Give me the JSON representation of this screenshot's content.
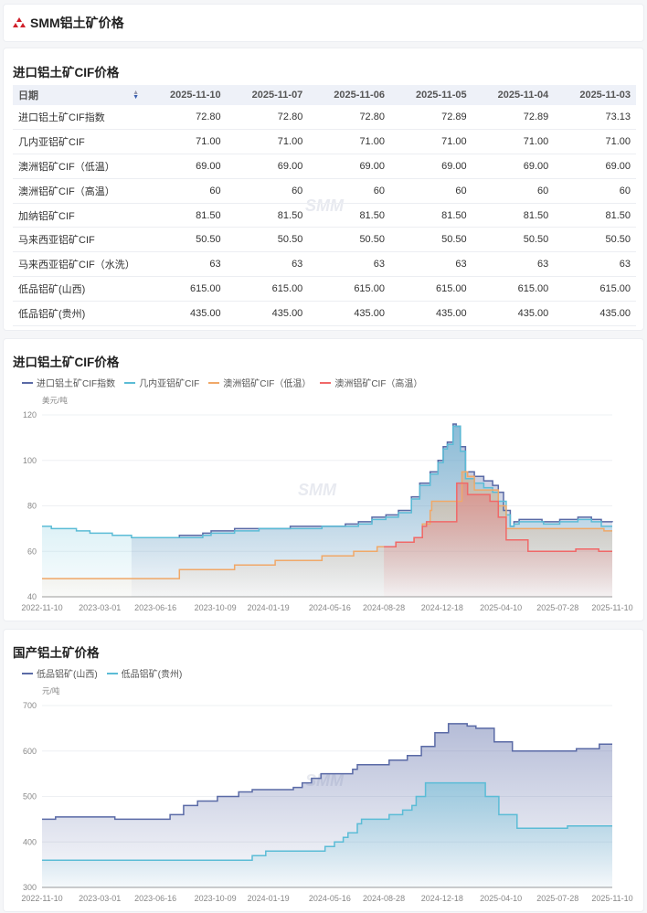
{
  "header": {
    "title": "SMM铝土矿价格",
    "logo": "smm-logo-icon"
  },
  "table_section": {
    "title": "进口铝土矿CIF价格",
    "columns": [
      "日期",
      "2025-11-10",
      "2025-11-07",
      "2025-11-06",
      "2025-11-05",
      "2025-11-04",
      "2025-11-03"
    ],
    "rows": [
      [
        "进口铝土矿CIF指数",
        "72.80",
        "72.80",
        "72.80",
        "72.89",
        "72.89",
        "73.13"
      ],
      [
        "几内亚铝矿CIF",
        "71.00",
        "71.00",
        "71.00",
        "71.00",
        "71.00",
        "71.00"
      ],
      [
        "澳洲铝矿CIF（低温）",
        "69.00",
        "69.00",
        "69.00",
        "69.00",
        "69.00",
        "69.00"
      ],
      [
        "澳洲铝矿CIF（高温）",
        "60",
        "60",
        "60",
        "60",
        "60",
        "60"
      ],
      [
        "加纳铝矿CIF",
        "81.50",
        "81.50",
        "81.50",
        "81.50",
        "81.50",
        "81.50"
      ],
      [
        "马来西亚铝矿CIF",
        "50.50",
        "50.50",
        "50.50",
        "50.50",
        "50.50",
        "50.50"
      ],
      [
        "马来西亚铝矿CIF（水洗）",
        "63",
        "63",
        "63",
        "63",
        "63",
        "63"
      ],
      [
        "低品铝矿(山西)",
        "615.00",
        "615.00",
        "615.00",
        "615.00",
        "615.00",
        "615.00"
      ],
      [
        "低品铝矿(贵州)",
        "435.00",
        "435.00",
        "435.00",
        "435.00",
        "435.00",
        "435.00"
      ]
    ]
  },
  "watermark": "SMM",
  "chart_data": [
    {
      "type": "area",
      "title": "进口铝土矿CIF价格",
      "ylabel": "美元/吨",
      "ylim": [
        40,
        120
      ],
      "yticks": [
        "40",
        "60",
        "80",
        "100",
        "120"
      ],
      "xlim": [
        "2022-11-10",
        "2025-11-10"
      ],
      "xticks": [
        "2022-11-10",
        "2023-03-01",
        "2023-06-16",
        "2023-10-09",
        "2024-01-19",
        "2024-05-16",
        "2024-08-28",
        "2024-12-18",
        "2025-04-10",
        "2025-07-28",
        "2025-11-10"
      ],
      "legend": "top-left",
      "grid": true,
      "series": [
        {
          "name": "进口铝土矿CIF指数",
          "color": "#5a6aa6",
          "points": [
            [
              "2023-05-01",
              66
            ],
            [
              "2023-08-01",
              67
            ],
            [
              "2023-09-15",
              68
            ],
            [
              "2023-10-01",
              69
            ],
            [
              "2023-11-15",
              70
            ],
            [
              "2024-03-01",
              71
            ],
            [
              "2024-06-15",
              72
            ],
            [
              "2024-07-10",
              73
            ],
            [
              "2024-08-05",
              75
            ],
            [
              "2024-09-01",
              76
            ],
            [
              "2024-09-25",
              78
            ],
            [
              "2024-10-20",
              84
            ],
            [
              "2024-11-05",
              90
            ],
            [
              "2024-11-25",
              95
            ],
            [
              "2024-12-10",
              100
            ],
            [
              "2024-12-20",
              106
            ],
            [
              "2024-12-28",
              108
            ],
            [
              "2025-01-08",
              116
            ],
            [
              "2025-01-14",
              115
            ],
            [
              "2025-01-22",
              106
            ],
            [
              "2025-02-01",
              95
            ],
            [
              "2025-02-18",
              93
            ],
            [
              "2025-03-08",
              91
            ],
            [
              "2025-03-25",
              89
            ],
            [
              "2025-04-05",
              86
            ],
            [
              "2025-04-15",
              78
            ],
            [
              "2025-04-28",
              71
            ],
            [
              "2025-05-05",
              73
            ],
            [
              "2025-05-15",
              74
            ],
            [
              "2025-06-28",
              73
            ],
            [
              "2025-08-01",
              74
            ],
            [
              "2025-09-05",
              75
            ],
            [
              "2025-10-01",
              74
            ],
            [
              "2025-10-20",
              73
            ],
            [
              "2025-11-10",
              72.8
            ]
          ]
        },
        {
          "name": "几内亚铝矿CIF",
          "color": "#5bbcd6",
          "points": [
            [
              "2022-11-10",
              71
            ],
            [
              "2022-11-28",
              70
            ],
            [
              "2023-01-15",
              69
            ],
            [
              "2023-02-10",
              68
            ],
            [
              "2023-03-25",
              67
            ],
            [
              "2023-05-01",
              66
            ],
            [
              "2023-08-01",
              66
            ],
            [
              "2023-09-15",
              67
            ],
            [
              "2023-10-01",
              68
            ],
            [
              "2023-11-15",
              69
            ],
            [
              "2024-01-01",
              70
            ],
            [
              "2024-05-01",
              71
            ],
            [
              "2024-07-10",
              72
            ],
            [
              "2024-08-05",
              74
            ],
            [
              "2024-09-01",
              75
            ],
            [
              "2024-09-25",
              77
            ],
            [
              "2024-10-20",
              83
            ],
            [
              "2024-11-05",
              89
            ],
            [
              "2024-11-25",
              94
            ],
            [
              "2024-12-10",
              99
            ],
            [
              "2024-12-20",
              105
            ],
            [
              "2024-12-28",
              107
            ],
            [
              "2025-01-08",
              115
            ],
            [
              "2025-01-22",
              104
            ],
            [
              "2025-02-01",
              92
            ],
            [
              "2025-02-18",
              90
            ],
            [
              "2025-03-08",
              88
            ],
            [
              "2025-03-25",
              86
            ],
            [
              "2025-04-05",
              82
            ],
            [
              "2025-04-20",
              76
            ],
            [
              "2025-04-28",
              71
            ],
            [
              "2025-05-05",
              72
            ],
            [
              "2025-05-15",
              73
            ],
            [
              "2025-07-01",
              72
            ],
            [
              "2025-08-01",
              73
            ],
            [
              "2025-09-05",
              74
            ],
            [
              "2025-10-01",
              73
            ],
            [
              "2025-10-20",
              71
            ],
            [
              "2025-11-10",
              71
            ]
          ]
        },
        {
          "name": "澳洲铝矿CIF（低温）",
          "color": "#f0a868",
          "points": [
            [
              "2022-11-10",
              48
            ],
            [
              "2023-08-01",
              52
            ],
            [
              "2023-11-15",
              54
            ],
            [
              "2024-02-01",
              56
            ],
            [
              "2024-05-01",
              58
            ],
            [
              "2024-07-01",
              60
            ],
            [
              "2024-08-15",
              62
            ],
            [
              "2024-09-20",
              64
            ],
            [
              "2024-10-25",
              66
            ],
            [
              "2024-11-10",
              72
            ],
            [
              "2024-11-25",
              78
            ],
            [
              "2024-11-28",
              82
            ],
            [
              "2025-01-25",
              95
            ],
            [
              "2025-02-05",
              93
            ],
            [
              "2025-02-18",
              87
            ],
            [
              "2025-04-05",
              80
            ],
            [
              "2025-04-20",
              70
            ],
            [
              "2025-10-25",
              69
            ],
            [
              "2025-11-10",
              69
            ]
          ]
        },
        {
          "name": "澳洲铝矿CIF（高温）",
          "color": "#f06868",
          "points": [
            [
              "2024-08-28",
              62
            ],
            [
              "2024-09-20",
              64
            ],
            [
              "2024-10-25",
              66
            ],
            [
              "2024-11-10",
              71
            ],
            [
              "2024-11-18",
              73
            ],
            [
              "2025-01-15",
              90
            ],
            [
              "2025-02-05",
              85
            ],
            [
              "2025-03-20",
              82
            ],
            [
              "2025-04-05",
              75
            ],
            [
              "2025-04-20",
              65
            ],
            [
              "2025-06-01",
              60
            ],
            [
              "2025-09-01",
              61
            ],
            [
              "2025-10-15",
              60
            ],
            [
              "2025-11-10",
              60
            ]
          ]
        }
      ]
    },
    {
      "type": "area",
      "title": "国产铝土矿价格",
      "ylabel": "元/吨",
      "ylim": [
        300,
        700
      ],
      "yticks": [
        "300",
        "400",
        "500",
        "600",
        "700"
      ],
      "xlim": [
        "2022-11-10",
        "2025-11-10"
      ],
      "xticks": [
        "2022-11-10",
        "2023-03-01",
        "2023-06-16",
        "2023-10-09",
        "2024-01-19",
        "2024-05-16",
        "2024-08-28",
        "2024-12-18",
        "2025-04-10",
        "2025-07-28",
        "2025-11-10"
      ],
      "legend": "top-left",
      "grid": true,
      "series": [
        {
          "name": "低品铝矿(山西)",
          "color": "#5a6aa6",
          "points": [
            [
              "2022-11-10",
              450
            ],
            [
              "2022-12-06",
              455
            ],
            [
              "2023-03-30",
              450
            ],
            [
              "2023-07-14",
              460
            ],
            [
              "2023-08-09",
              480
            ],
            [
              "2023-09-05",
              490
            ],
            [
              "2023-10-13",
              500
            ],
            [
              "2023-11-23",
              510
            ],
            [
              "2023-12-19",
              515
            ],
            [
              "2024-03-07",
              520
            ],
            [
              "2024-03-24",
              530
            ],
            [
              "2024-04-11",
              540
            ],
            [
              "2024-04-29",
              550
            ],
            [
              "2024-06-29",
              560
            ],
            [
              "2024-07-08",
              570
            ],
            [
              "2024-09-07",
              580
            ],
            [
              "2024-10-12",
              590
            ],
            [
              "2024-11-08",
              610
            ],
            [
              "2024-12-04",
              640
            ],
            [
              "2024-12-30",
              660
            ],
            [
              "2025-02-04",
              655
            ],
            [
              "2025-02-21",
              650
            ],
            [
              "2025-03-28",
              620
            ],
            [
              "2025-05-02",
              600
            ],
            [
              "2025-09-02",
              605
            ],
            [
              "2025-10-16",
              615
            ],
            [
              "2025-11-10",
              615
            ]
          ]
        },
        {
          "name": "低品铝矿(贵州)",
          "color": "#5bbcd6",
          "points": [
            [
              "2022-11-10",
              360
            ],
            [
              "2023-12-19",
              370
            ],
            [
              "2024-01-14",
              380
            ],
            [
              "2024-05-07",
              390
            ],
            [
              "2024-05-25",
              400
            ],
            [
              "2024-06-11",
              410
            ],
            [
              "2024-06-20",
              420
            ],
            [
              "2024-07-08",
              440
            ],
            [
              "2024-07-16",
              450
            ],
            [
              "2024-09-07",
              460
            ],
            [
              "2024-10-03",
              470
            ],
            [
              "2024-10-21",
              480
            ],
            [
              "2024-10-29",
              500
            ],
            [
              "2024-11-16",
              530
            ],
            [
              "2025-03-11",
              500
            ],
            [
              "2025-04-06",
              460
            ],
            [
              "2025-05-11",
              430
            ],
            [
              "2025-08-16",
              435
            ],
            [
              "2025-11-10",
              435
            ]
          ]
        }
      ]
    }
  ]
}
